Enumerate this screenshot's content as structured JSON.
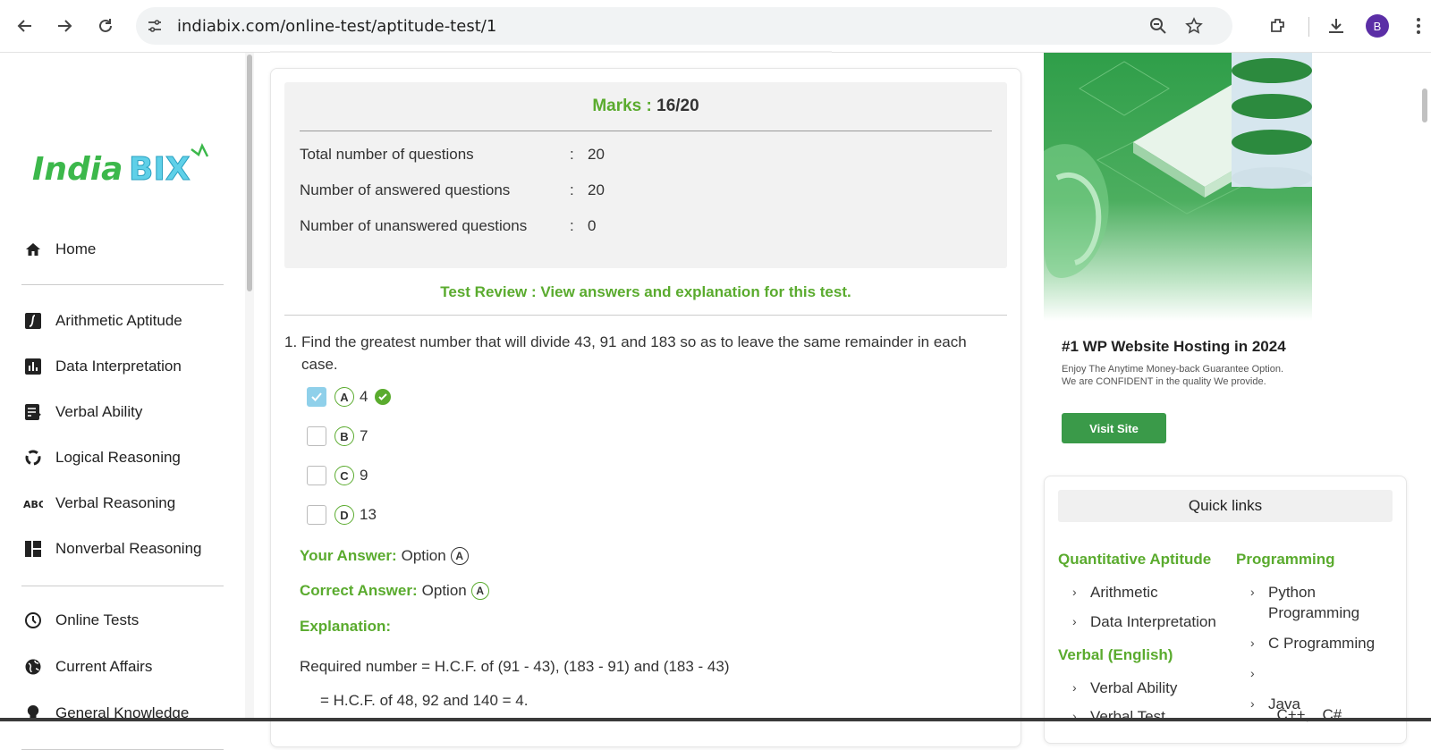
{
  "browser": {
    "url": "indiabix.com/online-test/aptitude-test/1",
    "profile_initial": "B",
    "icons": [
      "back-icon",
      "forward-icon",
      "reload-icon",
      "site-info-icon",
      "zoom-icon",
      "bookmark-star-icon",
      "extensions-icon",
      "download-icon",
      "kebab-menu-icon"
    ]
  },
  "sidebar": {
    "logo_text": "IndiaBIX",
    "items": [
      {
        "label": "Home",
        "icon": "home-icon"
      },
      {
        "label": "Arithmetic Aptitude",
        "icon": "integral-icon"
      },
      {
        "label": "Data Interpretation",
        "icon": "bar-chart-icon"
      },
      {
        "label": "Verbal Ability",
        "icon": "checklist-icon"
      },
      {
        "label": "Logical Reasoning",
        "icon": "cycle-icon"
      },
      {
        "label": "Verbal Reasoning",
        "icon": "abc-icon"
      },
      {
        "label": "Nonverbal Reasoning",
        "icon": "grid-icon"
      },
      {
        "label": "Online Tests",
        "icon": "clock-icon"
      },
      {
        "label": "Current Affairs",
        "icon": "globe-icon"
      },
      {
        "label": "General Knowledge",
        "icon": "bulb-icon"
      }
    ]
  },
  "result": {
    "marks_label": "Marks :",
    "marks_value": "16/20",
    "stats": [
      {
        "label": "Total number of questions",
        "sep": ":",
        "value": "20"
      },
      {
        "label": "Number of answered questions",
        "sep": ":",
        "value": "20"
      },
      {
        "label": "Number of unanswered questions",
        "sep": ":",
        "value": "0"
      }
    ],
    "review_link": "Test Review : View answers and explanation for this test."
  },
  "question": {
    "number": "1.",
    "text": "Find the greatest number that will divide 43, 91 and 183 so as to leave the same remainder in each case.",
    "options": [
      {
        "letter": "A",
        "value": "4",
        "checked": true,
        "correct": true
      },
      {
        "letter": "B",
        "value": "7",
        "checked": false
      },
      {
        "letter": "C",
        "value": "9",
        "checked": false
      },
      {
        "letter": "D",
        "value": "13",
        "checked": false
      }
    ],
    "your_answer_label": "Your Answer:",
    "your_answer_text": "Option",
    "your_answer_letter": "A",
    "correct_answer_label": "Correct Answer:",
    "correct_answer_text": "Option",
    "correct_answer_letter": "A",
    "explanation_label": "Explanation:",
    "explanation_lines": [
      "Required number = H.C.F. of (91 - 43), (183 - 91) and (183 - 43)",
      "= H.C.F. of 48, 92 and 140 = 4."
    ]
  },
  "ad": {
    "title": "#1 WP Website Hosting in 2024",
    "subtitle_1": "Enjoy The Anytime Money-back Guarantee Option.",
    "subtitle_2": "We are CONFIDENT in the quality We provide.",
    "button": "Visit Site"
  },
  "quick_links": {
    "title": "Quick links",
    "col1_head": "Quantitative Aptitude",
    "col1_links": [
      "Arithmetic",
      "Data Interpretation"
    ],
    "col1_head2": "Verbal (English)",
    "col1_links2": [
      "Verbal Ability",
      "Verbal Test"
    ],
    "col2_head": "Programming",
    "col2_links": [
      "Python Programming",
      "C Programming",
      "C++,   C#",
      "Java"
    ]
  },
  "colors": {
    "accent_green": "#5aab2e",
    "checkbox_checked": "#8fd0ea",
    "ad_green": "#3a9a49"
  }
}
